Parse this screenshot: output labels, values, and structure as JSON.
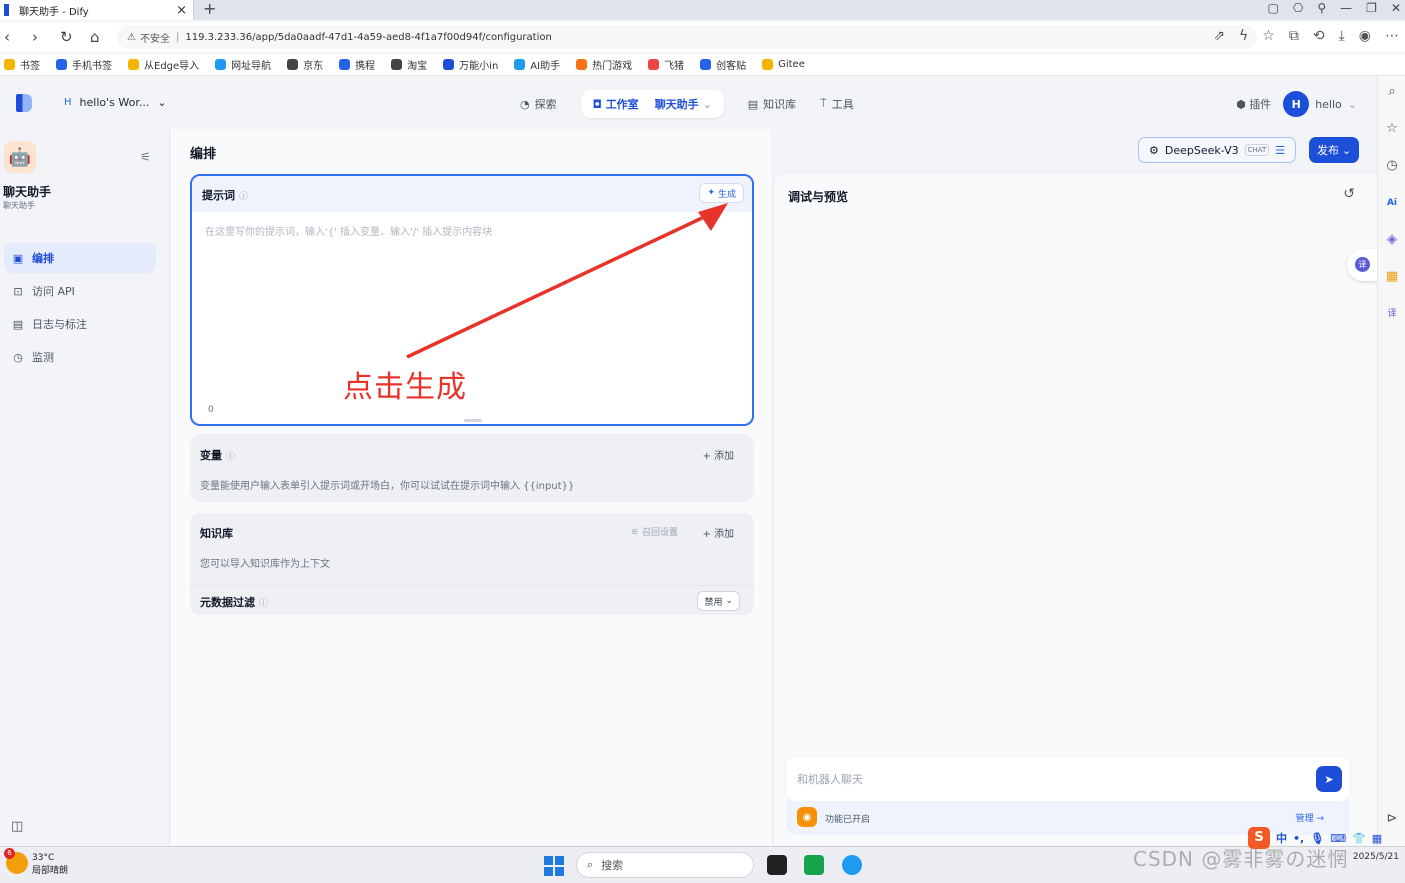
{
  "browser": {
    "tab_title": "聊天助手 - Dify",
    "tab_close": "×",
    "new_tab": "+",
    "insecure_label": "不安全",
    "url": "119.3.233.36/app/5da0aadf-47d1-4a59-aed8-4f1a7f00d94f/configuration",
    "bookmarks": [
      "书签",
      "手机书签",
      "从Edge导入",
      "网址导航",
      "京东",
      "携程",
      "淘宝",
      "万能小in",
      "AI助手",
      "热门游戏",
      "飞猪",
      "创客贴",
      "Gitee"
    ],
    "bookmark_colors": [
      "#f5b400",
      "#2563eb",
      "#f5b400",
      "#1d9bf0",
      "#444444",
      "#2563eb",
      "#444444",
      "#1d4ed8",
      "#1d9bf0",
      "#f97316",
      "#ef4444",
      "#2563eb",
      "#f5b400"
    ]
  },
  "header": {
    "workspace_initial": "H",
    "workspace_name": "hello's Wor...",
    "nav_explore": "探索",
    "nav_studio": "工作室",
    "nav_app": "聊天助手",
    "nav_knowledge": "知识库",
    "nav_tools": "工具",
    "plugins": "插件",
    "user_initial": "H",
    "user_name": "hello"
  },
  "sidebar": {
    "app_name": "聊天助手",
    "app_type": "聊天助手",
    "items": [
      {
        "label": "编排",
        "icon": "layout-icon"
      },
      {
        "label": "访问 API",
        "icon": "terminal-icon"
      },
      {
        "label": "日志与标注",
        "icon": "log-icon"
      },
      {
        "label": "监测",
        "icon": "monitor-icon"
      }
    ]
  },
  "main": {
    "title": "编排",
    "prompt": {
      "label": "提示词",
      "generate": "生成",
      "placeholder": "在这里写你的提示词，输入'{' 插入变量、输入'/' 插入提示内容块",
      "count": "0"
    },
    "annotation": "点击生成",
    "variables": {
      "label": "变量",
      "add": "+ 添加",
      "desc": "变量能使用户输入表单引入提示词或开场白，你可以试试在提示词中输入 {{input}}"
    },
    "knowledge": {
      "label": "知识库",
      "recall_settings": "召回设置",
      "add": "+ 添加",
      "desc": "您可以导入知识库作为上下文",
      "metadata_filter": "元数据过滤",
      "filter_value": "禁用"
    }
  },
  "debug": {
    "model_name": "DeepSeek-V3",
    "model_badge": "CHAT",
    "publish": "发布",
    "title": "调试与预览",
    "chat_placeholder": "和机器人聊天",
    "features_on": "功能已开启",
    "manage": "管理 →"
  },
  "taskbar": {
    "temperature": "33°C",
    "weather": "局部晴朗",
    "weather_badge": "6",
    "search": "搜索",
    "date": "2025/5/21",
    "ime": "中"
  },
  "watermark": "CSDN @雾非雾の迷惘"
}
